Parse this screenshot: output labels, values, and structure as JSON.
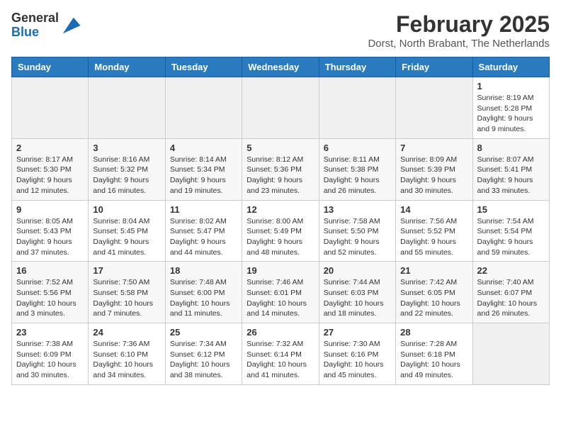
{
  "header": {
    "logo": {
      "general": "General",
      "blue": "Blue"
    },
    "title": "February 2025",
    "subtitle": "Dorst, North Brabant, The Netherlands"
  },
  "calendar": {
    "days_of_week": [
      "Sunday",
      "Monday",
      "Tuesday",
      "Wednesday",
      "Thursday",
      "Friday",
      "Saturday"
    ],
    "weeks": [
      [
        {
          "num": "",
          "info": ""
        },
        {
          "num": "",
          "info": ""
        },
        {
          "num": "",
          "info": ""
        },
        {
          "num": "",
          "info": ""
        },
        {
          "num": "",
          "info": ""
        },
        {
          "num": "",
          "info": ""
        },
        {
          "num": "1",
          "info": "Sunrise: 8:19 AM\nSunset: 5:28 PM\nDaylight: 9 hours and 9 minutes."
        }
      ],
      [
        {
          "num": "2",
          "info": "Sunrise: 8:17 AM\nSunset: 5:30 PM\nDaylight: 9 hours and 12 minutes."
        },
        {
          "num": "3",
          "info": "Sunrise: 8:16 AM\nSunset: 5:32 PM\nDaylight: 9 hours and 16 minutes."
        },
        {
          "num": "4",
          "info": "Sunrise: 8:14 AM\nSunset: 5:34 PM\nDaylight: 9 hours and 19 minutes."
        },
        {
          "num": "5",
          "info": "Sunrise: 8:12 AM\nSunset: 5:36 PM\nDaylight: 9 hours and 23 minutes."
        },
        {
          "num": "6",
          "info": "Sunrise: 8:11 AM\nSunset: 5:38 PM\nDaylight: 9 hours and 26 minutes."
        },
        {
          "num": "7",
          "info": "Sunrise: 8:09 AM\nSunset: 5:39 PM\nDaylight: 9 hours and 30 minutes."
        },
        {
          "num": "8",
          "info": "Sunrise: 8:07 AM\nSunset: 5:41 PM\nDaylight: 9 hours and 33 minutes."
        }
      ],
      [
        {
          "num": "9",
          "info": "Sunrise: 8:05 AM\nSunset: 5:43 PM\nDaylight: 9 hours and 37 minutes."
        },
        {
          "num": "10",
          "info": "Sunrise: 8:04 AM\nSunset: 5:45 PM\nDaylight: 9 hours and 41 minutes."
        },
        {
          "num": "11",
          "info": "Sunrise: 8:02 AM\nSunset: 5:47 PM\nDaylight: 9 hours and 44 minutes."
        },
        {
          "num": "12",
          "info": "Sunrise: 8:00 AM\nSunset: 5:49 PM\nDaylight: 9 hours and 48 minutes."
        },
        {
          "num": "13",
          "info": "Sunrise: 7:58 AM\nSunset: 5:50 PM\nDaylight: 9 hours and 52 minutes."
        },
        {
          "num": "14",
          "info": "Sunrise: 7:56 AM\nSunset: 5:52 PM\nDaylight: 9 hours and 55 minutes."
        },
        {
          "num": "15",
          "info": "Sunrise: 7:54 AM\nSunset: 5:54 PM\nDaylight: 9 hours and 59 minutes."
        }
      ],
      [
        {
          "num": "16",
          "info": "Sunrise: 7:52 AM\nSunset: 5:56 PM\nDaylight: 10 hours and 3 minutes."
        },
        {
          "num": "17",
          "info": "Sunrise: 7:50 AM\nSunset: 5:58 PM\nDaylight: 10 hours and 7 minutes."
        },
        {
          "num": "18",
          "info": "Sunrise: 7:48 AM\nSunset: 6:00 PM\nDaylight: 10 hours and 11 minutes."
        },
        {
          "num": "19",
          "info": "Sunrise: 7:46 AM\nSunset: 6:01 PM\nDaylight: 10 hours and 14 minutes."
        },
        {
          "num": "20",
          "info": "Sunrise: 7:44 AM\nSunset: 6:03 PM\nDaylight: 10 hours and 18 minutes."
        },
        {
          "num": "21",
          "info": "Sunrise: 7:42 AM\nSunset: 6:05 PM\nDaylight: 10 hours and 22 minutes."
        },
        {
          "num": "22",
          "info": "Sunrise: 7:40 AM\nSunset: 6:07 PM\nDaylight: 10 hours and 26 minutes."
        }
      ],
      [
        {
          "num": "23",
          "info": "Sunrise: 7:38 AM\nSunset: 6:09 PM\nDaylight: 10 hours and 30 minutes."
        },
        {
          "num": "24",
          "info": "Sunrise: 7:36 AM\nSunset: 6:10 PM\nDaylight: 10 hours and 34 minutes."
        },
        {
          "num": "25",
          "info": "Sunrise: 7:34 AM\nSunset: 6:12 PM\nDaylight: 10 hours and 38 minutes."
        },
        {
          "num": "26",
          "info": "Sunrise: 7:32 AM\nSunset: 6:14 PM\nDaylight: 10 hours and 41 minutes."
        },
        {
          "num": "27",
          "info": "Sunrise: 7:30 AM\nSunset: 6:16 PM\nDaylight: 10 hours and 45 minutes."
        },
        {
          "num": "28",
          "info": "Sunrise: 7:28 AM\nSunset: 6:18 PM\nDaylight: 10 hours and 49 minutes."
        },
        {
          "num": "",
          "info": ""
        }
      ]
    ]
  }
}
